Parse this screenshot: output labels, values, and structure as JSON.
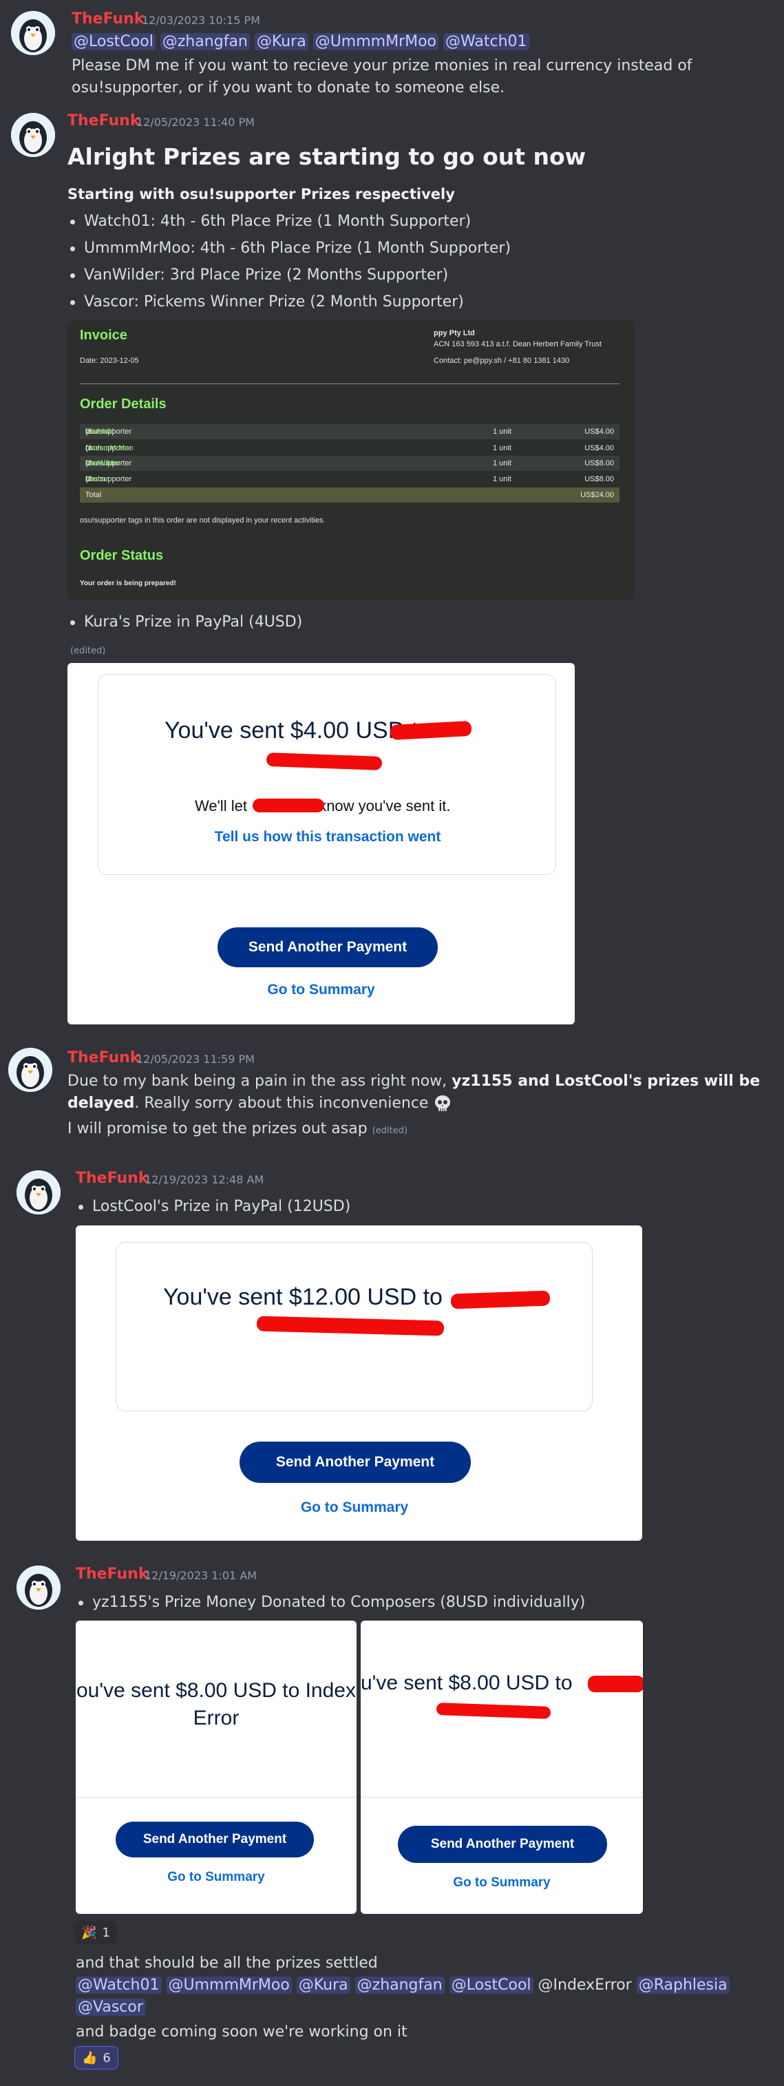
{
  "messages": [
    {
      "author": "TheFunk",
      "timestamp": "12/03/2023 10:15 PM",
      "mentions": [
        "@LostCool",
        "@zhangfan",
        "@Kura",
        "@UmmmMrMoo",
        "@Watch01"
      ],
      "text": "Please DM me if you want to recieve your prize monies in real currency instead of osu!supporter, or if you want to donate to someone else."
    },
    {
      "author": "TheFunk",
      "timestamp": "12/05/2023 11:40 PM",
      "heading": "Alright Prizes are starting to go out now",
      "subheading": "Starting with osu!supporter Prizes respectively",
      "bullets": [
        "Watch01: 4th - 6th Place Prize (1 Month Supporter)",
        "UmmmMrMoo: 4th - 6th Place Prize (1 Month Supporter)",
        "VanWilder: 3rd Place Prize (2 Months Supporter)",
        "Vascor: Pickems Winner Prize (2 Month Supporter)"
      ],
      "bullet_after": "Kura's Prize in PayPal (4USD)",
      "edited": "(edited)"
    },
    {
      "author": "TheFunk",
      "timestamp": "12/05/2023 11:59 PM",
      "text_pre": "Due to my bank being a pain in the ass right now, ",
      "text_bold": "yz1155 and LostCool's prizes will be delayed",
      "text_post": ". Really sorry about this inconvenience",
      "text_line2": "I will promise to get the prizes out asap",
      "edited": "(edited)"
    },
    {
      "author": "TheFunk",
      "timestamp": "12/19/2023 12:48 AM",
      "bullet": "LostCool's Prize in PayPal (12USD)"
    },
    {
      "author": "TheFunk",
      "timestamp": "12/19/2023 1:01 AM",
      "bullet": "yz1155's Prize Money Donated to Composers (8USD individually)"
    }
  ],
  "invoice": {
    "title": "Invoice",
    "date": "Date: 2023-12-05",
    "company": "ppy Pty Ltd",
    "acn": "ACN 163 593 413 a.t.f. Dean Herbert Family Trust",
    "contact": "Contact: pe@ppy.sh / +81 80 1381 1430",
    "order_details": "Order Details",
    "rows": [
      {
        "pre": "osu!supporter tag for ",
        "name": "Watch01",
        "post": " (1 month)",
        "qty": "1 unit",
        "price": "US$4.00"
      },
      {
        "pre": "osu!supporter tag for ",
        "name": "UmmmMrMoo",
        "post": " (1 month)",
        "qty": "1 unit",
        "price": "US$4.00"
      },
      {
        "pre": "osu!supporter tag for ",
        "name": "VanWilder",
        "post": " (2 months)",
        "qty": "1 unit",
        "price": "US$8.00"
      },
      {
        "pre": "osu!supporter tag for ",
        "name": "Vascor",
        "post": " (2 months)",
        "qty": "1 unit",
        "price": "US$8.00"
      }
    ],
    "total_label": "Total",
    "total_value": "US$24.00",
    "note": "osu!supporter tags in this order are not displayed in your recent activities.",
    "order_status": "Order Status",
    "status_text": "Your order is being prepared!"
  },
  "paypal_kura": {
    "sent": "You've sent $4.00 USD to",
    "notify_pre": "We'll let",
    "notify_post": "know you've sent it.",
    "feedback": "Tell us how this transaction went",
    "send_another": "Send Another Payment",
    "summary": "Go to Summary"
  },
  "paypal_lostcool": {
    "sent": "You've sent $12.00 USD to",
    "send_another": "Send Another Payment",
    "summary": "Go to Summary"
  },
  "paypal_index": {
    "sent_line1": "ou've sent $8.00 USD to Index",
    "sent_line2": "Error",
    "send_another": "Send Another Payment",
    "summary": "Go to Summary"
  },
  "paypal_other": {
    "sent": "u've sent $8.00 USD to",
    "send_another": "Send Another Payment",
    "summary": "Go to Summary"
  },
  "reactions": {
    "party": {
      "emoji": "🎉",
      "count": "1"
    },
    "thumbs": {
      "emoji": "👍",
      "count": "6"
    }
  },
  "followup": {
    "settled": "and that should be all the prizes settled",
    "mentions": [
      "@Watch01",
      "@UmmmMrMoo",
      "@Kura",
      "@zhangfan",
      "@LostCool"
    ],
    "plain_mention": "@IndexError",
    "mentions2": [
      "@Raphlesia",
      "@Vascor"
    ],
    "badge": "and badge coming soon we're working on it"
  },
  "colors": {
    "author": "#f23f42",
    "background": "#313338",
    "paypal_blue": "#003087",
    "mention_bg": "#3c4270"
  }
}
